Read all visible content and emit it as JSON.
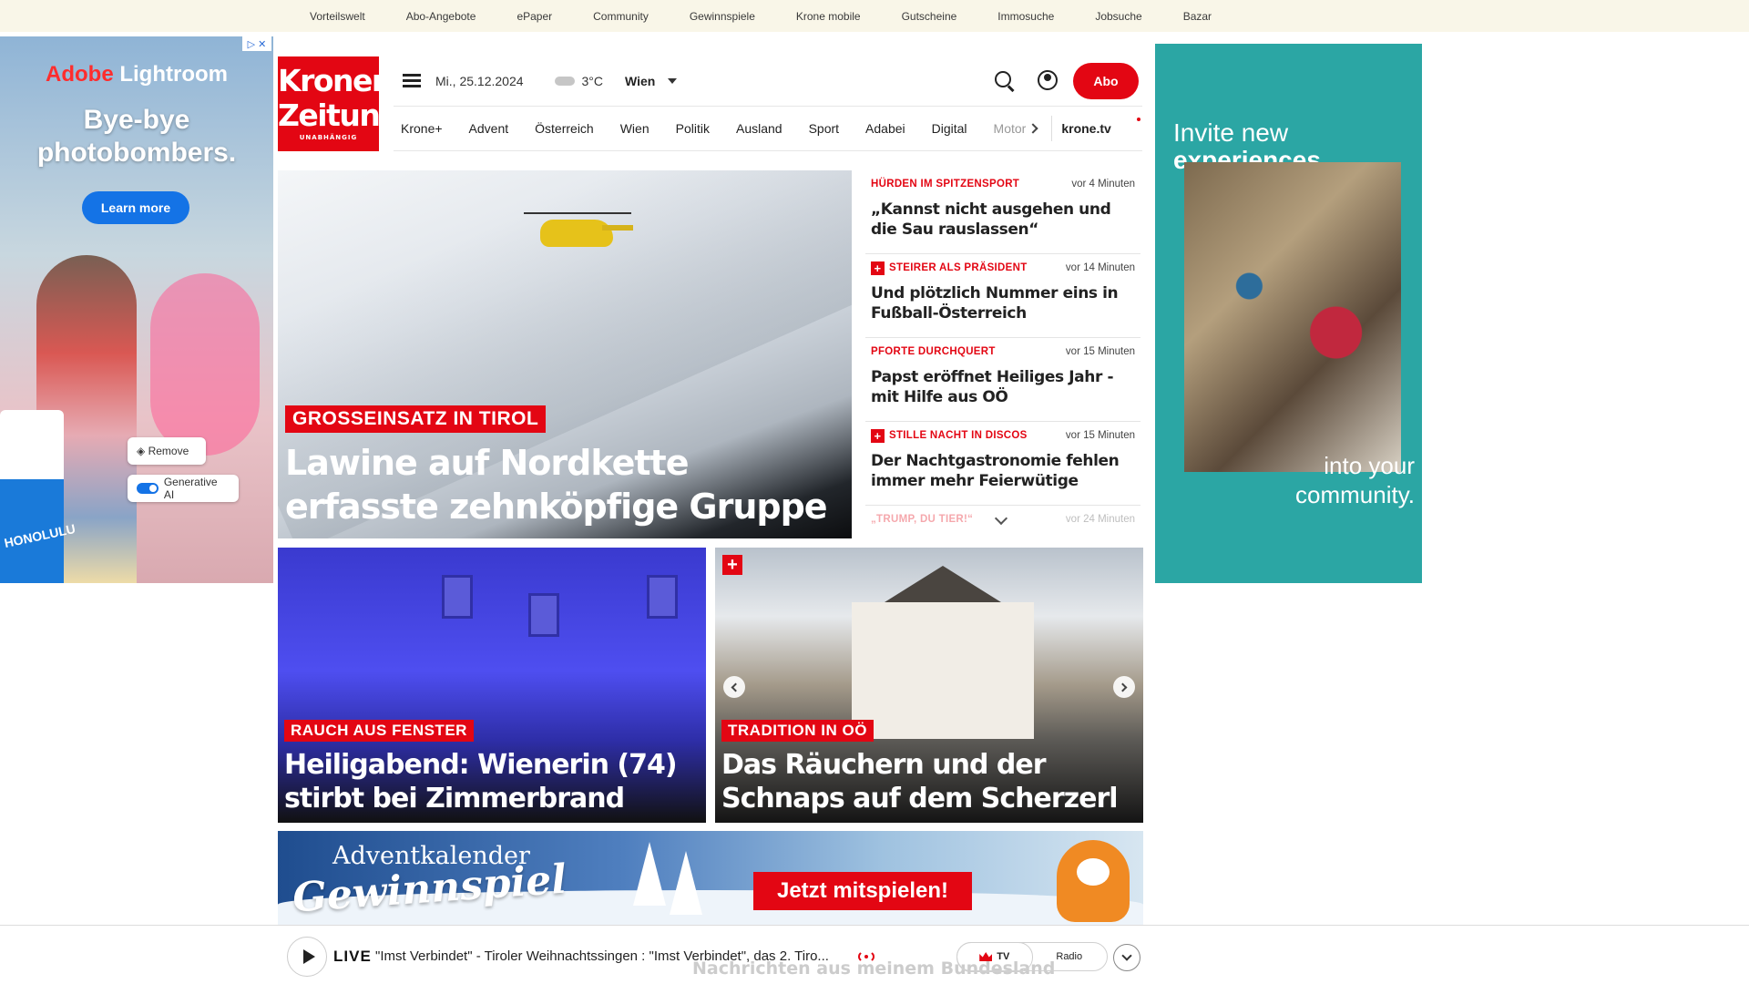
{
  "topbar": {
    "links": [
      "Vorteilswelt",
      "Abo-Angebote",
      "ePaper",
      "Community",
      "Gewinnspiele",
      "Krone mobile",
      "Gutscheine",
      "Immosuche",
      "Jobsuche",
      "Bazar"
    ]
  },
  "ad_left": {
    "brand_red": "Adobe",
    "brand_white": "Lightroom",
    "headline_1": "Bye-bye",
    "headline_2": "photobombers.",
    "cta": "Learn more",
    "remove_label": "Remove",
    "genai_label": "Generative AI",
    "cup_text": "HONOLULU"
  },
  "ad_right": {
    "line1": "Invite new",
    "line2": "experiences",
    "line3": "into your",
    "line4": "community."
  },
  "header": {
    "logo_line1": "Kronen",
    "logo_line2": "Zeitung",
    "logo_tag": "UNABHÄNGIG",
    "date": "Mi., 25.12.2024",
    "temperature": "3°C",
    "city": "Wien",
    "abo_label": "Abo"
  },
  "nav": {
    "tabs": [
      "Krone+",
      "Advent",
      "Österreich",
      "Wien",
      "Politik",
      "Ausland",
      "Sport",
      "Adabei",
      "Digital"
    ],
    "faded_tab": "Motor",
    "tv": "krone.tv"
  },
  "hero": {
    "kicker": "GROSSEINSATZ IN TIROL",
    "title": "Lawine auf Nordkette erfasste zehnköpfige Gruppe"
  },
  "news": [
    {
      "kicker": "HÜRDEN IM SPITZENSPORT",
      "plus": false,
      "time": "vor 4 Minuten",
      "headline": "„Kannst nicht ausgehen und die Sau rauslassen“"
    },
    {
      "kicker": "STEIRER ALS PRÄSIDENT",
      "plus": true,
      "time": "vor 14 Minuten",
      "headline": "Und plötzlich Nummer eins in Fußball-Österreich"
    },
    {
      "kicker": "PFORTE DURCHQUERT",
      "plus": false,
      "time": "vor 15 Minuten",
      "headline": "Papst eröffnet Heiliges Jahr - mit Hilfe aus OÖ"
    },
    {
      "kicker": "STILLE NACHT IN DISCOS",
      "plus": true,
      "time": "vor 15 Minuten",
      "headline": "Der Nachtgastronomie fehlen immer mehr Feierwütige"
    },
    {
      "kicker": "„TRUMP, DU TIER!“",
      "plus": false,
      "time": "vor 24 Minuten",
      "headline": ""
    }
  ],
  "cards": [
    {
      "kicker": "RAUCH AUS FENSTER",
      "title": "Heiligabend: Wienerin (74) stirbt bei Zimmerbrand"
    },
    {
      "kicker": "TRADITION IN OÖ",
      "title": "Das Räuchern und der Schnaps auf dem Scherzerl",
      "plus": "+"
    }
  ],
  "advent": {
    "line1": "Adventkalender",
    "line2": "Gewinnspiel",
    "cta": "Jetzt mitspielen!"
  },
  "player": {
    "live_label": "LIVE",
    "live_text": "\"Imst Verbindet\" - Tiroler Weihnachtssingen : \"Imst Verbindet\", das 2. Tiro...",
    "tv_label": "TV",
    "radio_label": "Radio",
    "underlying_text": "Nachrichten aus meinem Bundesland"
  },
  "colors": {
    "brand_red": "#e30613",
    "topbar_bg": "#f9f6e8",
    "ad_right_bg": "#2ba6a4"
  }
}
